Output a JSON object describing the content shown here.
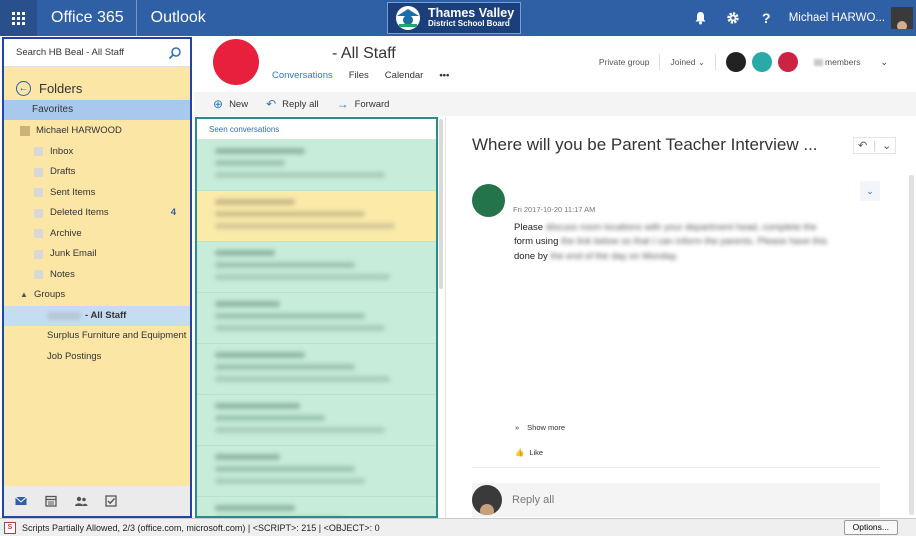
{
  "topbar": {
    "brand": "Office 365",
    "app": "Outlook",
    "org_line1": "Thames Valley",
    "org_line2": "District School Board",
    "username": "Michael HARWO...",
    "icons": [
      "bell-icon",
      "gear-icon",
      "help-icon"
    ]
  },
  "folder_pane": {
    "search_placeholder": "Search HB Beal - All Staff",
    "folders_label": "Folders",
    "favorites_label": "Favorites",
    "account_name": "Michael HARWOOD",
    "folders": [
      {
        "name": "Inbox",
        "count": ""
      },
      {
        "name": "Drafts",
        "count": ""
      },
      {
        "name": "Sent Items",
        "count": ""
      },
      {
        "name": "Deleted Items",
        "count": "4"
      },
      {
        "name": "Archive",
        "count": ""
      },
      {
        "name": "Junk Email",
        "count": ""
      },
      {
        "name": "Notes",
        "count": ""
      }
    ],
    "groups_label": "Groups",
    "groups": [
      {
        "name": "- All Staff",
        "selected": true
      },
      {
        "name": "Surplus Furniture and Equipment",
        "selected": false
      },
      {
        "name": "Job Postings",
        "selected": false
      }
    ]
  },
  "group_header": {
    "title": "- All Staff",
    "tabs": [
      "Conversations",
      "Files",
      "Calendar",
      "•••"
    ],
    "privacy": "Private group",
    "joined": "Joined",
    "members_label": "members",
    "member_colors": [
      "#222222",
      "#2aa9a9",
      "#cc2244"
    ]
  },
  "commands": {
    "new": "New",
    "reply_all": "Reply all",
    "forward": "Forward"
  },
  "conversation_list": {
    "header": "Seen conversations"
  },
  "message": {
    "title": "Where will you be Parent Teacher Interview ...",
    "date": "Fri 2017-10-20 11:17 AM",
    "body_1": "Please",
    "body_1b": "discuss room locations with your department head, complete the",
    "body_2": "form using",
    "body_2b": "the link below so that I can inform the parents.  Please have this",
    "body_3": "done by",
    "body_3b": "the end of the day on Monday.",
    "show_more": "Show more",
    "like": "Like",
    "reply_all": "Reply all"
  },
  "statusbar": {
    "text": "Scripts Partially Allowed, 2/3 (office.com, microsoft.com) | <SCRIPT>: 215 | <OBJECT>: 0",
    "options": "Options..."
  },
  "colors": {
    "topbar": "#2f5fa5",
    "folder_pane_bg": "#fbe6a6",
    "conv_bg": "#c7ecd9",
    "group_avatar": "#e8203e",
    "sender_avatar": "#23744a",
    "accent": "#2f7ac0"
  }
}
